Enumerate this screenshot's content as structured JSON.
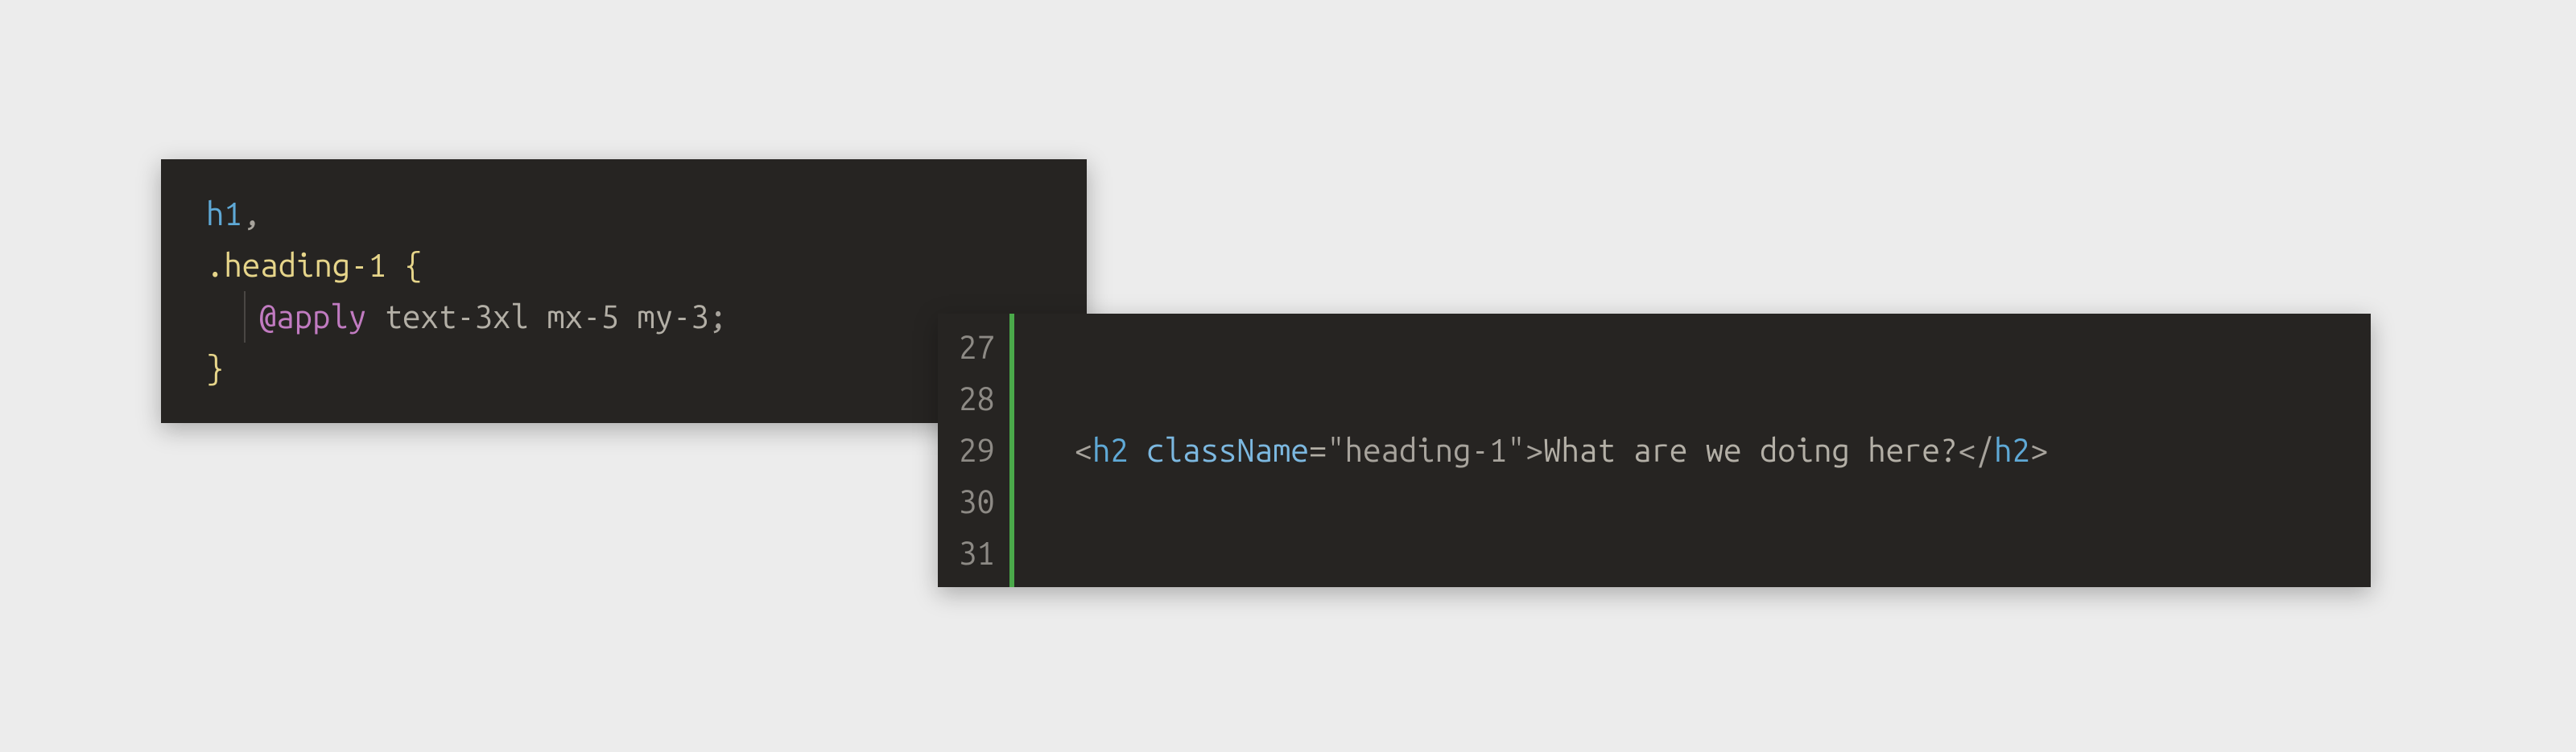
{
  "block1": {
    "line1": {
      "tag": "h1",
      "comma": ","
    },
    "line2": {
      "selector": ".heading-1",
      "space": " ",
      "brace": "{"
    },
    "line3": {
      "atrule": "@apply",
      "space": " ",
      "values": "text-3xl mx-5 my-3",
      "semi": ";"
    },
    "line4": {
      "brace": "}"
    }
  },
  "block2": {
    "lineNumbers": [
      "27",
      "28",
      "29",
      "30",
      "31"
    ],
    "codeLine": {
      "lt": "<",
      "tagOpen": "h2",
      "sp": " ",
      "attrName": "className",
      "eq": "=",
      "quote1": "\"",
      "strVal": "heading-1",
      "quote2": "\"",
      "gt": ">",
      "text": "What are we doing here?",
      "ltClose": "</",
      "tagClose": "h2",
      "gtClose": ">"
    }
  }
}
